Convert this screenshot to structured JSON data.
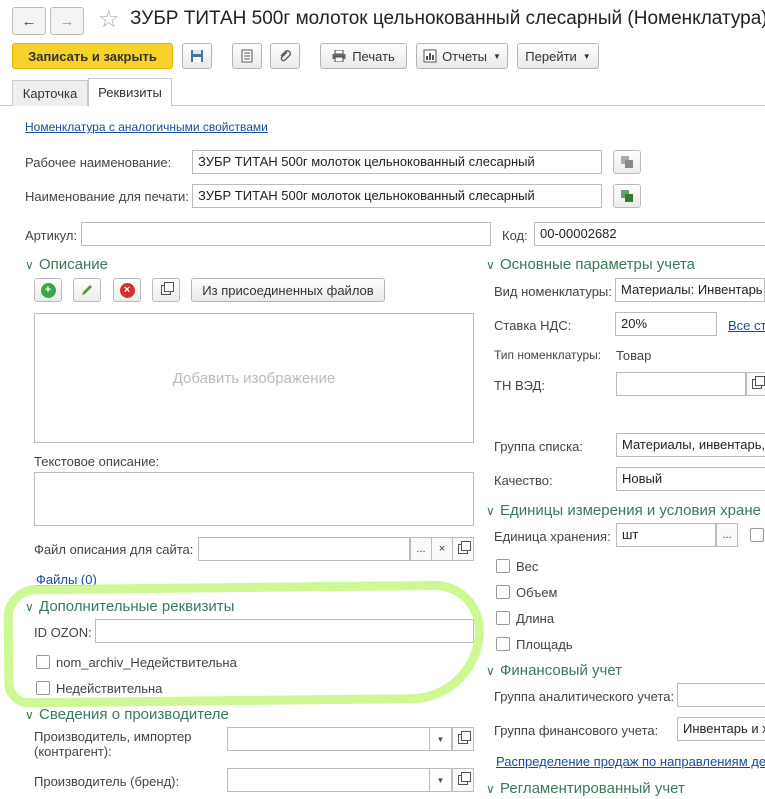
{
  "window": {
    "title": "ЗУБР ТИТАН 500г молоток цельнокованный слесарный (Номенклатура)"
  },
  "toolbar": {
    "save_close": "Записать и закрыть",
    "print": "Печать",
    "reports": "Отчеты",
    "go": "Перейти"
  },
  "tabs": [
    {
      "label": "Карточка"
    },
    {
      "label": "Реквизиты"
    }
  ],
  "links": {
    "similar": "Номенклатура с аналогичными свойствами",
    "files": "Файлы (0)",
    "vat_all": "Все ст",
    "sales_dist": "Распределение продаж по направлениям де"
  },
  "fields": {
    "work_name_label": "Рабочее наименование:",
    "work_name_value": "ЗУБР ТИТАН 500г молоток цельнокованный слесарный",
    "print_name_label": "Наименование для печати:",
    "print_name_value": "ЗУБР ТИТАН 500г молоток цельнокованный слесарный",
    "article_label": "Артикул:",
    "article_value": "",
    "code_label": "Код:",
    "code_value": "00-00002682"
  },
  "description": {
    "section": "Описание",
    "from_files": "Из присоединенных файлов",
    "add_image": "Добавить изображение",
    "text_desc_label": "Текстовое описание:",
    "site_file_label": "Файл описания для сайта:",
    "site_file_dots": "...",
    "clear": "×"
  },
  "extra": {
    "section": "Дополнительные реквизиты",
    "ozon_label": "ID OZON:",
    "ozon_value": "",
    "cb1": "nom_archiv_Недействительна",
    "cb2": "Недействительна"
  },
  "producer": {
    "section": "Сведения о производителе",
    "importer_label_1": "Производитель, импортер",
    "importer_label_2": "(контрагент):",
    "brand_label": "Производитель (бренд):"
  },
  "accounting": {
    "section": "Основные параметры учета",
    "kind_label": "Вид номенклатуры:",
    "kind_value": "Материалы: Инвентарь и",
    "vat_label": "Ставка НДС:",
    "vat_value": "20%",
    "type_label": "Тип номенклатуры:",
    "type_value": "Товар",
    "tnved_label": "ТН ВЭД:",
    "group_label": "Группа списка:",
    "group_value": "Материалы, инвентарь, ",
    "quality_label": "Качество:",
    "quality_value": "Новый"
  },
  "units": {
    "section": "Единицы измерения и условия хране",
    "storage_label": "Единица хранения:",
    "storage_value": "шт",
    "weight": "Вес",
    "volume": "Объем",
    "length": "Длина",
    "area": "Площадь"
  },
  "finance": {
    "section": "Финансовый учет",
    "analytic_label": "Группа аналитического учета:",
    "fin_label": "Группа финансового учета:",
    "fin_value": "Инвентарь и х"
  },
  "regulated": {
    "section": "Регламентированный учет"
  },
  "colors": {
    "primary": "#f7d22b",
    "section": "#3a7a5a",
    "link": "#1a4b9c",
    "highlight": "#c9f78a"
  }
}
